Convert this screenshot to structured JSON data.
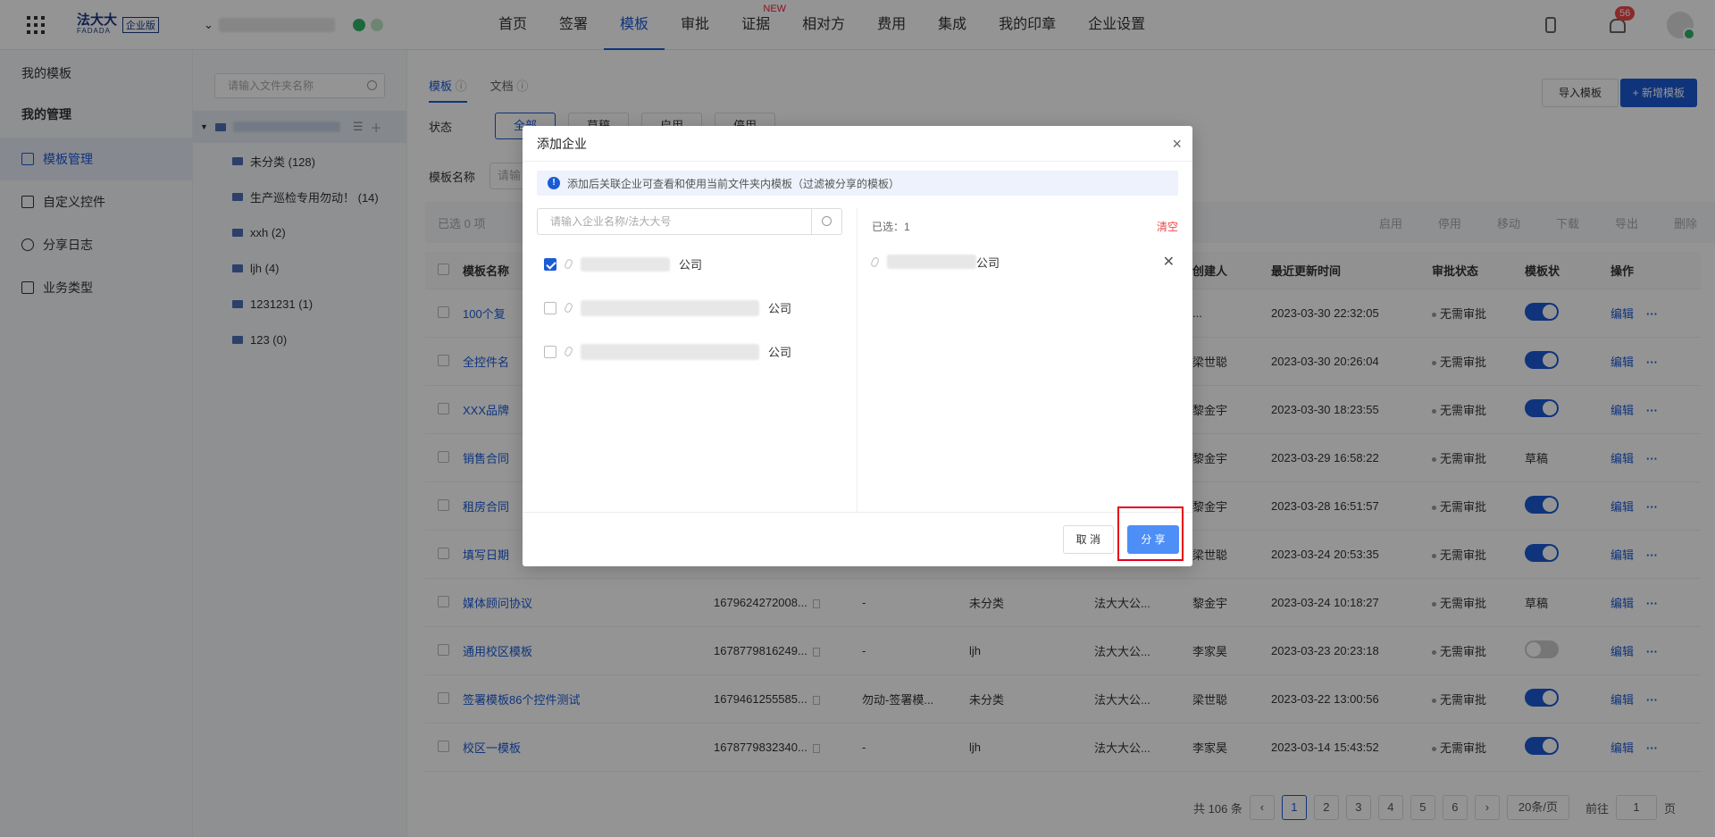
{
  "header": {
    "logo_main": "法大大",
    "logo_sub": "FADADA",
    "logo_badge": "企业版",
    "nav": [
      {
        "label": "首页"
      },
      {
        "label": "签署"
      },
      {
        "label": "模板"
      },
      {
        "label": "审批"
      },
      {
        "label": "证据",
        "badge": "NEW"
      },
      {
        "label": "相对方"
      },
      {
        "label": "费用"
      },
      {
        "label": "集成"
      },
      {
        "label": "我的印章"
      },
      {
        "label": "企业设置"
      }
    ],
    "notification_count": "56"
  },
  "sidebar": {
    "section_templates": "我的模板",
    "section_manage": "我的管理",
    "items": [
      {
        "label": "模板管理",
        "icon": "template-icon"
      },
      {
        "label": "自定义控件",
        "icon": "control-icon"
      },
      {
        "label": "分享日志",
        "icon": "clock-icon"
      },
      {
        "label": "业务类型",
        "icon": "list-icon"
      }
    ]
  },
  "tree": {
    "search_placeholder": "请输入文件夹名称",
    "folders": [
      {
        "label": "未分类 (128)"
      },
      {
        "label": "生产巡检专用勿动！ (14)"
      },
      {
        "label": "xxh (2)"
      },
      {
        "label": "ljh (4)"
      },
      {
        "label": "1231231 (1)"
      },
      {
        "label": "123 (0)"
      }
    ]
  },
  "main": {
    "tabs": [
      "模板",
      "文档"
    ],
    "import_label": "导入模板",
    "new_label": "+ 新增模板",
    "filter_status_label": "状态",
    "filter_chips": [
      "全部",
      "草稿",
      "启用",
      "停用"
    ],
    "name_label": "模板名称",
    "name_placeholder": "请输",
    "selected_text": "已选 0 项",
    "toolbar_actions": [
      "启用",
      "停用",
      "移动",
      "下载",
      "导出",
      "删除"
    ],
    "columns": {
      "name": "模板名称",
      "creator": "创建人",
      "updated": "最近更新时间",
      "approval": "审批状态",
      "status": "模板状",
      "ops": "操作"
    },
    "rows": [
      {
        "name": "100个复",
        "id": "",
        "doc": "",
        "folder": "",
        "org": "",
        "creator": "...",
        "time": "2023-03-30 22:32:05",
        "approval": "无需审批",
        "status": "on"
      },
      {
        "name": "全控件名",
        "id": "",
        "doc": "",
        "folder": "",
        "org": "",
        "creator": "梁世聪",
        "time": "2023-03-30 20:26:04",
        "approval": "无需审批",
        "status": "on"
      },
      {
        "name": "XXX品牌",
        "id": "",
        "doc": "",
        "folder": "",
        "org": "",
        "creator": "黎金宇",
        "time": "2023-03-30 18:23:55",
        "approval": "无需审批",
        "status": "on"
      },
      {
        "name": "销售合同",
        "id": "",
        "doc": "",
        "folder": "",
        "org": "",
        "creator": "黎金宇",
        "time": "2023-03-29 16:58:22",
        "approval": "无需审批",
        "status": "草稿"
      },
      {
        "name": "租房合同",
        "id": "",
        "doc": "",
        "folder": "",
        "org": "",
        "creator": "黎金宇",
        "time": "2023-03-28 16:51:57",
        "approval": "无需审批",
        "status": "on"
      },
      {
        "name": "填写日期",
        "id": "",
        "doc": "",
        "folder": "",
        "org": "",
        "creator": "梁世聪",
        "time": "2023-03-24 20:53:35",
        "approval": "无需审批",
        "status": "on"
      },
      {
        "name": "媒体顾问协议",
        "id": "1679624272008...",
        "doc": "-",
        "folder": "未分类",
        "org": "法大大公...",
        "creator": "黎金宇",
        "time": "2023-03-24 10:18:27",
        "approval": "无需审批",
        "status": "草稿"
      },
      {
        "name": "通用校区模板",
        "id": "1678779816249...",
        "doc": "-",
        "folder": "ljh",
        "org": "法大大公...",
        "creator": "李家昊",
        "time": "2023-03-23 20:23:18",
        "approval": "无需审批",
        "status": "off"
      },
      {
        "name": "签署模板86个控件测试",
        "id": "1679461255585...",
        "doc": "勿动-签署模...",
        "folder": "未分类",
        "org": "法大大公...",
        "creator": "梁世聪",
        "time": "2023-03-22 13:00:56",
        "approval": "无需审批",
        "status": "on"
      },
      {
        "name": "校区一模板",
        "id": "1678779832340...",
        "doc": "-",
        "folder": "ljh",
        "org": "法大大公...",
        "creator": "李家昊",
        "time": "2023-03-14 15:43:52",
        "approval": "无需审批",
        "status": "on"
      }
    ],
    "edit_label": "编辑",
    "more_label": "···",
    "pagination": {
      "total": "共 106 条",
      "pages": [
        "1",
        "2",
        "3",
        "4",
        "5",
        "6"
      ],
      "current": "1",
      "page_size": "20条/页",
      "goto_label": "前往",
      "goto_value": "1",
      "page_suffix": "页"
    }
  },
  "modal": {
    "title": "添加企业",
    "notice": "添加后关联企业可查看和使用当前文件夹内模板（过滤被分享的模板）",
    "search_placeholder": "请输入企业名称/法大大号",
    "companies": [
      {
        "suffix": "公司",
        "checked": true
      },
      {
        "suffix": "公司",
        "checked": false
      },
      {
        "suffix": "公司",
        "checked": false
      }
    ],
    "selected_count": "已选：1",
    "clear_label": "清空",
    "selected": [
      {
        "suffix": "公司"
      }
    ],
    "cancel_label": "取 消",
    "share_label": "分 享"
  },
  "colors": {
    "primary": "#1a5bd6",
    "share_button": "#4d8ef7",
    "highlight": "#e5001a"
  }
}
